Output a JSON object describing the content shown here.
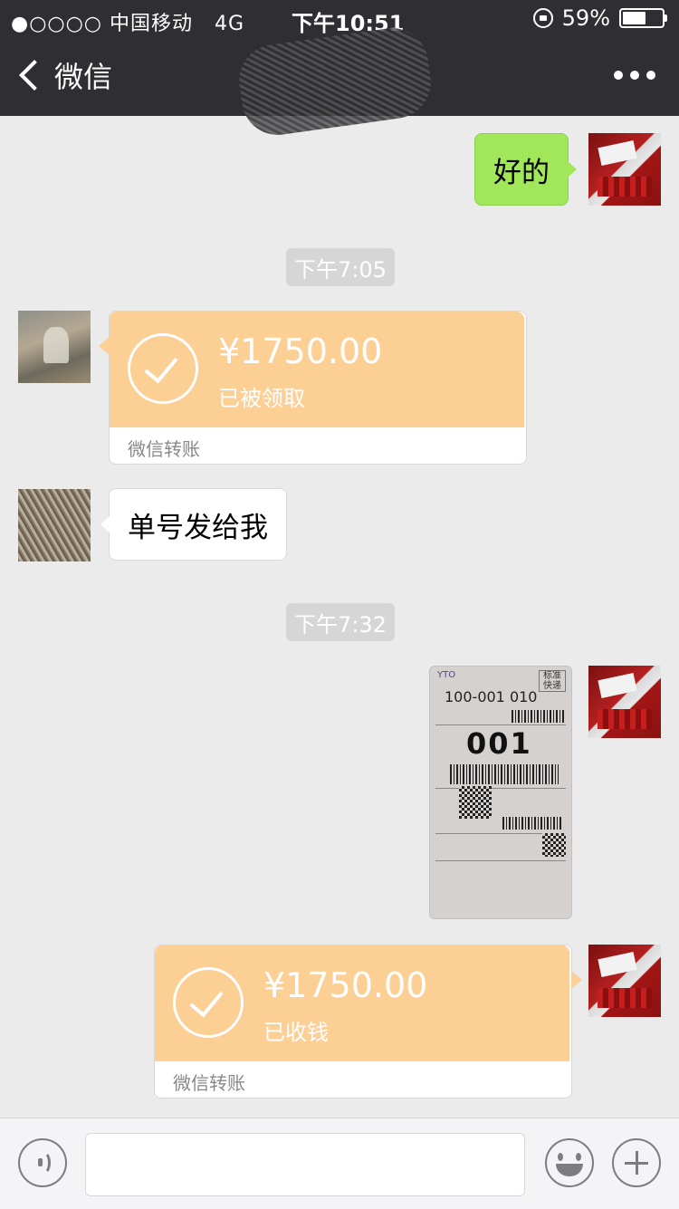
{
  "status_bar": {
    "signal": "●○○○○",
    "carrier": "中国移动",
    "network": "4G",
    "time": "下午10:51",
    "battery": "59%",
    "battery_level": 0.59
  },
  "nav": {
    "back_label": "微信"
  },
  "messages": {
    "m1_text": "好的",
    "time1": "下午7:05",
    "t1_amount": "¥1750.00",
    "t1_status": "已被领取",
    "t1_footer": "微信转账",
    "m3_text": "单号发给我",
    "time2": "下午7:32",
    "waybill_code": "100-001 010",
    "waybill_big": "001",
    "waybill_std": "标准快递",
    "t2_amount": "¥1750.00",
    "t2_status": "已收钱",
    "t2_footer": "微信转账"
  },
  "input": {
    "value": ""
  },
  "colors": {
    "nav_bg": "#2e2e33",
    "chat_bg": "#ebebeb",
    "bubble_green": "#a0e75a",
    "transfer_orange": "#fccf95"
  },
  "icons": [
    "back-chevron-icon",
    "more-icon",
    "lock-icon",
    "battery-icon",
    "voice-icon",
    "emoji-icon",
    "plus-icon",
    "check-circle-icon"
  ]
}
